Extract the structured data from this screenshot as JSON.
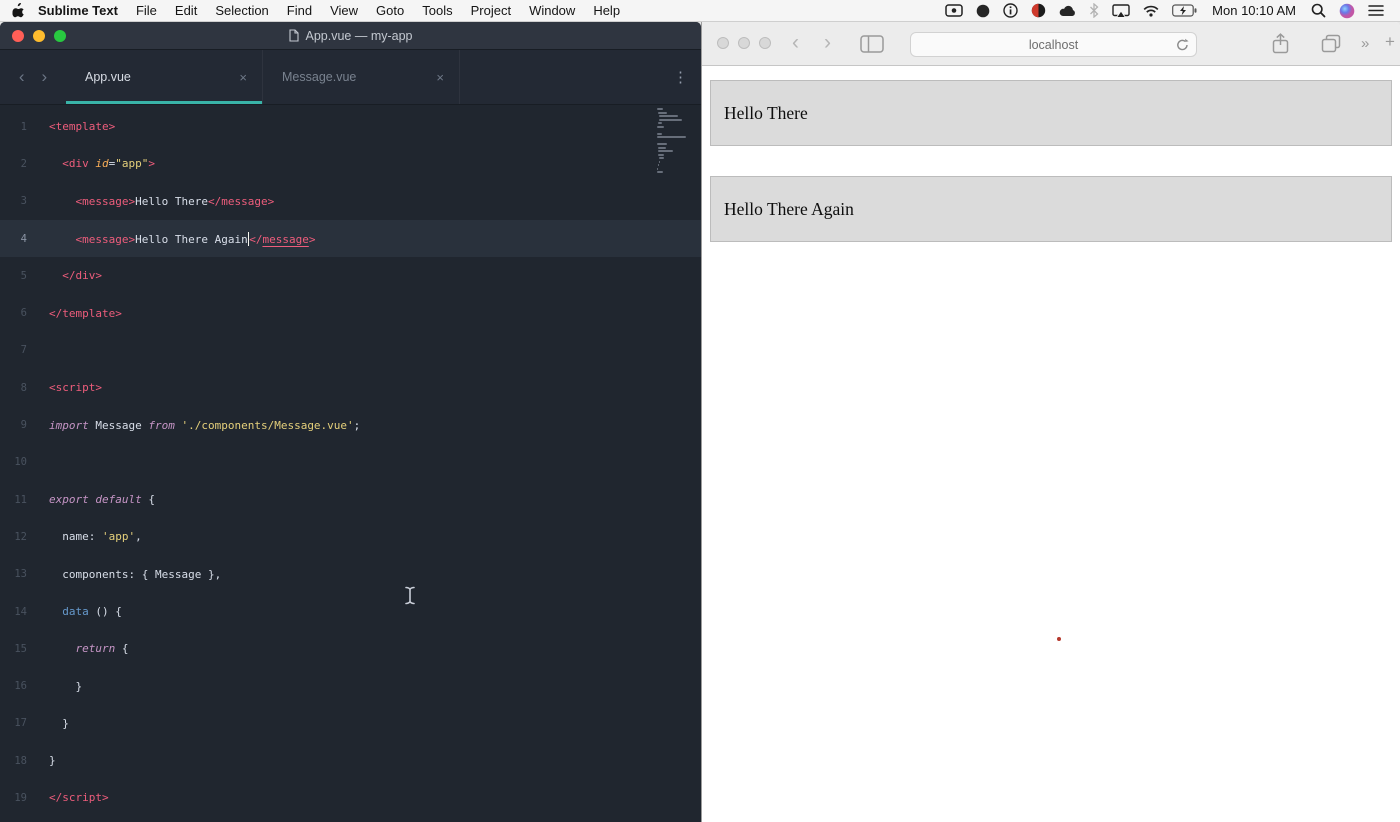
{
  "menu_bar": {
    "app_name": "Sublime Text",
    "menus": [
      "File",
      "Edit",
      "Selection",
      "Find",
      "View",
      "Goto",
      "Tools",
      "Project",
      "Window",
      "Help"
    ],
    "clock": "Mon 10:10 AM"
  },
  "sublime_window": {
    "title": "App.vue — my-app",
    "nav_back": "‹",
    "nav_forward": "›",
    "overflow_glyph": "⋮",
    "close_glyph": "×",
    "tabs": [
      {
        "label": "App.vue",
        "active": true
      },
      {
        "label": "Message.vue",
        "active": false
      }
    ],
    "colors": {
      "editor_background": "#20262f",
      "tag": "#ee5d7c",
      "attribute": "#f9ae58",
      "string": "#e5d07b",
      "keyword": "#c695c6",
      "storage": "#6699cc",
      "text": "#d8dee9",
      "active_tab_underline": "#39b3a8"
    },
    "lines": [
      {
        "num": 1,
        "segments": [
          {
            "t": "<template>",
            "c": "tag"
          }
        ]
      },
      {
        "num": 2,
        "segments": [
          {
            "t": "  "
          },
          {
            "t": "<div ",
            "c": "tag"
          },
          {
            "t": "id",
            "c": "attr"
          },
          {
            "t": "="
          },
          {
            "t": "\"app\"",
            "c": "string"
          },
          {
            "t": ">",
            "c": "tag"
          }
        ]
      },
      {
        "num": 3,
        "segments": [
          {
            "t": "    "
          },
          {
            "t": "<message>",
            "c": "tag"
          },
          {
            "t": "Hello There"
          },
          {
            "t": "</message>",
            "c": "tag"
          }
        ]
      },
      {
        "num": 4,
        "active": true,
        "segments": [
          {
            "t": "    "
          },
          {
            "t": "<message>",
            "c": "tag"
          },
          {
            "t": "Hello There Again"
          },
          {
            "cursor": true
          },
          {
            "t": "</",
            "c": "tag"
          },
          {
            "t": "message",
            "c": "tag underline"
          },
          {
            "t": ">",
            "c": "tag"
          }
        ]
      },
      {
        "num": 5,
        "segments": [
          {
            "t": "  "
          },
          {
            "t": "</div>",
            "c": "tag"
          }
        ]
      },
      {
        "num": 6,
        "segments": [
          {
            "t": "</template>",
            "c": "tag"
          }
        ]
      },
      {
        "num": 7,
        "segments": []
      },
      {
        "num": 8,
        "segments": [
          {
            "t": "<script>",
            "c": "tag"
          }
        ]
      },
      {
        "num": 9,
        "segments": [
          {
            "t": "import",
            "c": "keyword"
          },
          {
            "t": " Message "
          },
          {
            "t": "from",
            "c": "keyword"
          },
          {
            "t": " "
          },
          {
            "t": "'./components/Message.vue'",
            "c": "string"
          },
          {
            "t": ";"
          }
        ]
      },
      {
        "num": 10,
        "segments": []
      },
      {
        "num": 11,
        "segments": [
          {
            "t": "export default",
            "c": "keyword"
          },
          {
            "t": " {"
          }
        ]
      },
      {
        "num": 12,
        "segments": [
          {
            "t": "  name: "
          },
          {
            "t": "'app'",
            "c": "string"
          },
          {
            "t": ","
          }
        ]
      },
      {
        "num": 13,
        "segments": [
          {
            "t": "  components: { Message },"
          }
        ]
      },
      {
        "num": 14,
        "segments": [
          {
            "t": "  "
          },
          {
            "t": "data",
            "c": "storage"
          },
          {
            "t": " () {"
          }
        ]
      },
      {
        "num": 15,
        "segments": [
          {
            "t": "    "
          },
          {
            "t": "return",
            "c": "keyword"
          },
          {
            "t": " {"
          }
        ]
      },
      {
        "num": 16,
        "segments": [
          {
            "t": "    }"
          }
        ]
      },
      {
        "num": 17,
        "segments": [
          {
            "t": "  }"
          }
        ]
      },
      {
        "num": 18,
        "segments": [
          {
            "t": "}"
          }
        ]
      },
      {
        "num": 19,
        "segments": [
          {
            "t": "</script>",
            "c": "tag"
          }
        ]
      }
    ]
  },
  "safari_window": {
    "url": "localhost",
    "back_glyph": "‹",
    "forward_glyph": "›",
    "overflow_glyph": "»",
    "new_tab_glyph": "+",
    "messages": [
      "Hello There",
      "Hello There Again"
    ]
  }
}
